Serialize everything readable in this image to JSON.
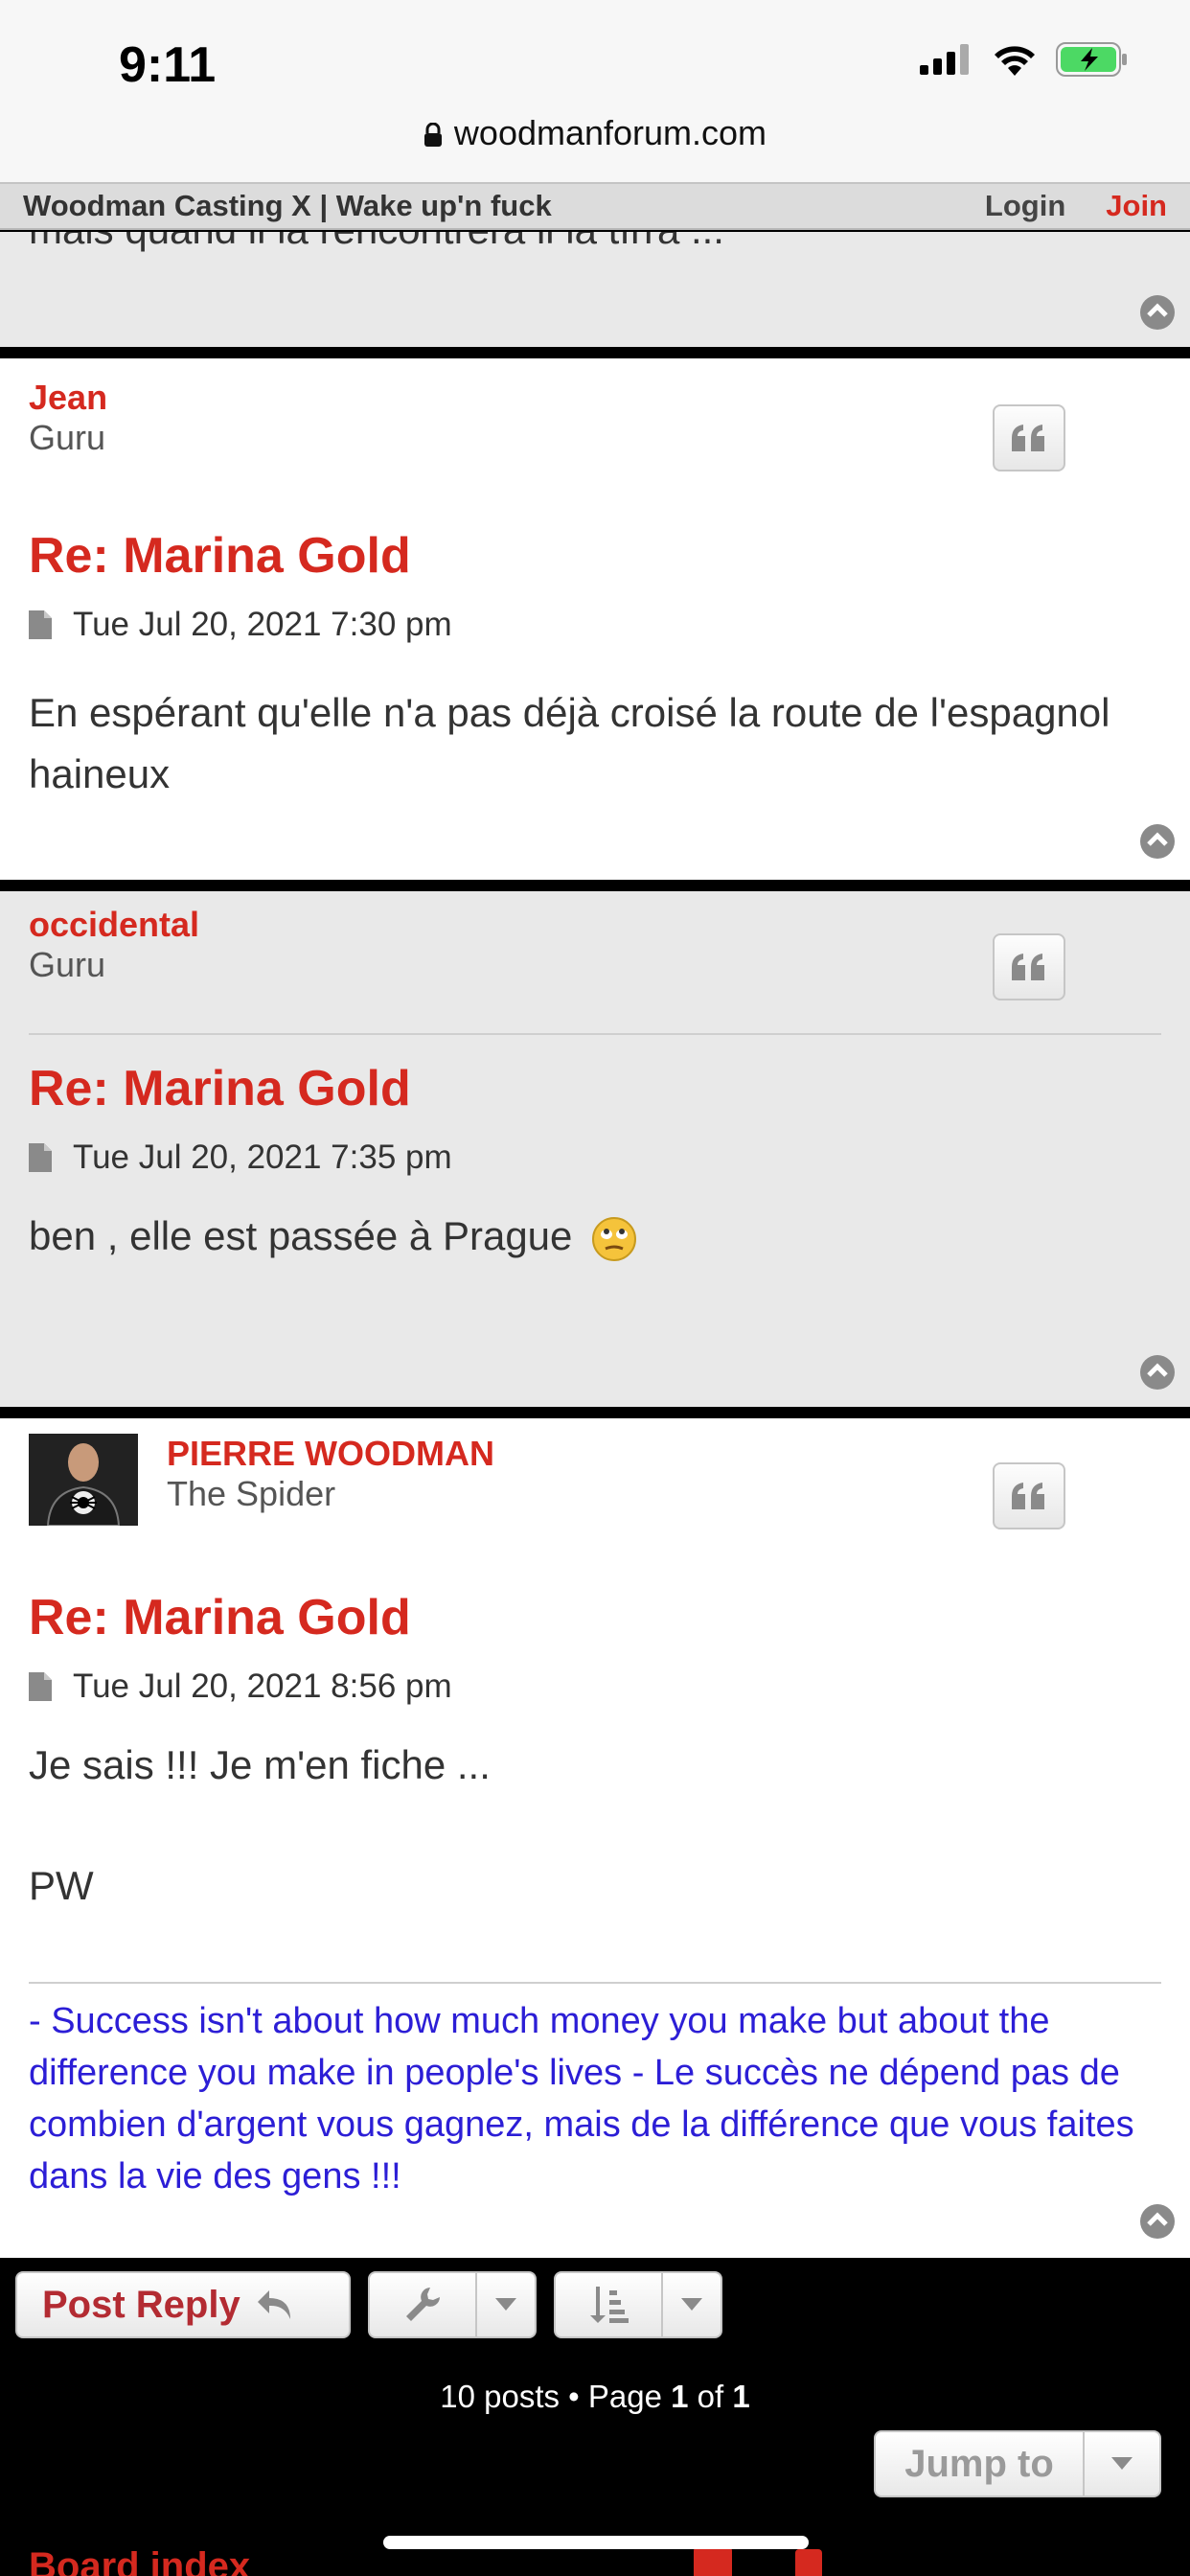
{
  "status_bar": {
    "time": "9:11"
  },
  "browser": {
    "url": "woodmanforum.com"
  },
  "nav": {
    "site_title": "Woodman Casting X | Wake up'n fuck",
    "login": "Login",
    "join": "Join"
  },
  "previous_post": {
    "fragment": "mais quand il la rencontrera il la tîrra ..."
  },
  "posts": [
    {
      "author": "Jean",
      "rank": "Guru",
      "title": "Re: Marina Gold",
      "date": "Tue Jul 20, 2021 7:30 pm",
      "body": "En espérant qu'elle n'a pas déjà croisé la route de l'espagnol haineux"
    },
    {
      "author": "occidental",
      "rank": "Guru",
      "title": "Re: Marina Gold",
      "date": "Tue Jul 20, 2021 7:35 pm",
      "body": "ben , elle est passée à Prague"
    },
    {
      "author": "PIERRE WOODMAN",
      "rank": "The Spider",
      "title": "Re: Marina Gold",
      "date": "Tue Jul 20, 2021 8:56 pm",
      "body_line1": "Je sais !!! Je m'en fiche ...",
      "body_line2": "PW",
      "signature": "- Success isn't about how much money you make but about the difference you make in people's lives - Le succès ne dépend pas de combien d'argent vous gagnez, mais de la différence que vous faites dans la vie des gens !!!"
    }
  ],
  "actions": {
    "post_reply": "Post Reply",
    "pagination_prefix": "10 posts • Page",
    "page_current": "1",
    "page_of": "of",
    "page_total": "1",
    "jump_to": "Jump to",
    "partial_footer": "Board index"
  },
  "colors": {
    "accent": "#d5291f",
    "signature": "#2c1ed6",
    "post_gray": "#e9e9e9"
  }
}
